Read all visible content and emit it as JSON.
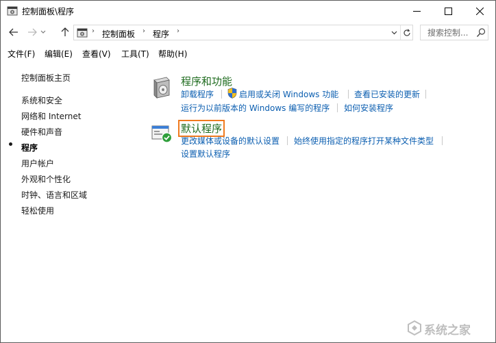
{
  "window": {
    "title": "控制面板\\程序",
    "controls": {
      "minimize": "—",
      "maximize": "☐",
      "close": "✕"
    }
  },
  "address": {
    "crumbs": [
      "控制面板",
      "程序"
    ],
    "search_placeholder": "搜索控制..."
  },
  "menu": [
    "文件(F)",
    "编辑(E)",
    "查看(V)",
    "工具(T)",
    "帮助(H)"
  ],
  "leftnav": {
    "home": "控制面板主页",
    "items": [
      "系统和安全",
      "网络和 Internet",
      "硬件和声音",
      "程序",
      "用户帐户",
      "外观和个性化",
      "时钟、语言和区域",
      "轻松使用"
    ],
    "current_index": 3
  },
  "categories": {
    "programs_features": {
      "title": "程序和功能",
      "links": [
        "卸载程序",
        "启用或关闭 Windows 功能",
        "查看已安装的更新",
        "运行为以前版本的 Windows 编写的程序",
        "如何安装程序"
      ]
    },
    "default_programs": {
      "title": "默认程序",
      "links": [
        "更改媒体或设备的默认设置",
        "始终使用指定的程序打开某种文件类型",
        "设置默认程序"
      ]
    }
  },
  "watermark": {
    "text": "系统之家"
  },
  "colors": {
    "link": "#0b5eb0",
    "category_title": "#1e6b1e",
    "highlight_border": "#f07a1e"
  }
}
